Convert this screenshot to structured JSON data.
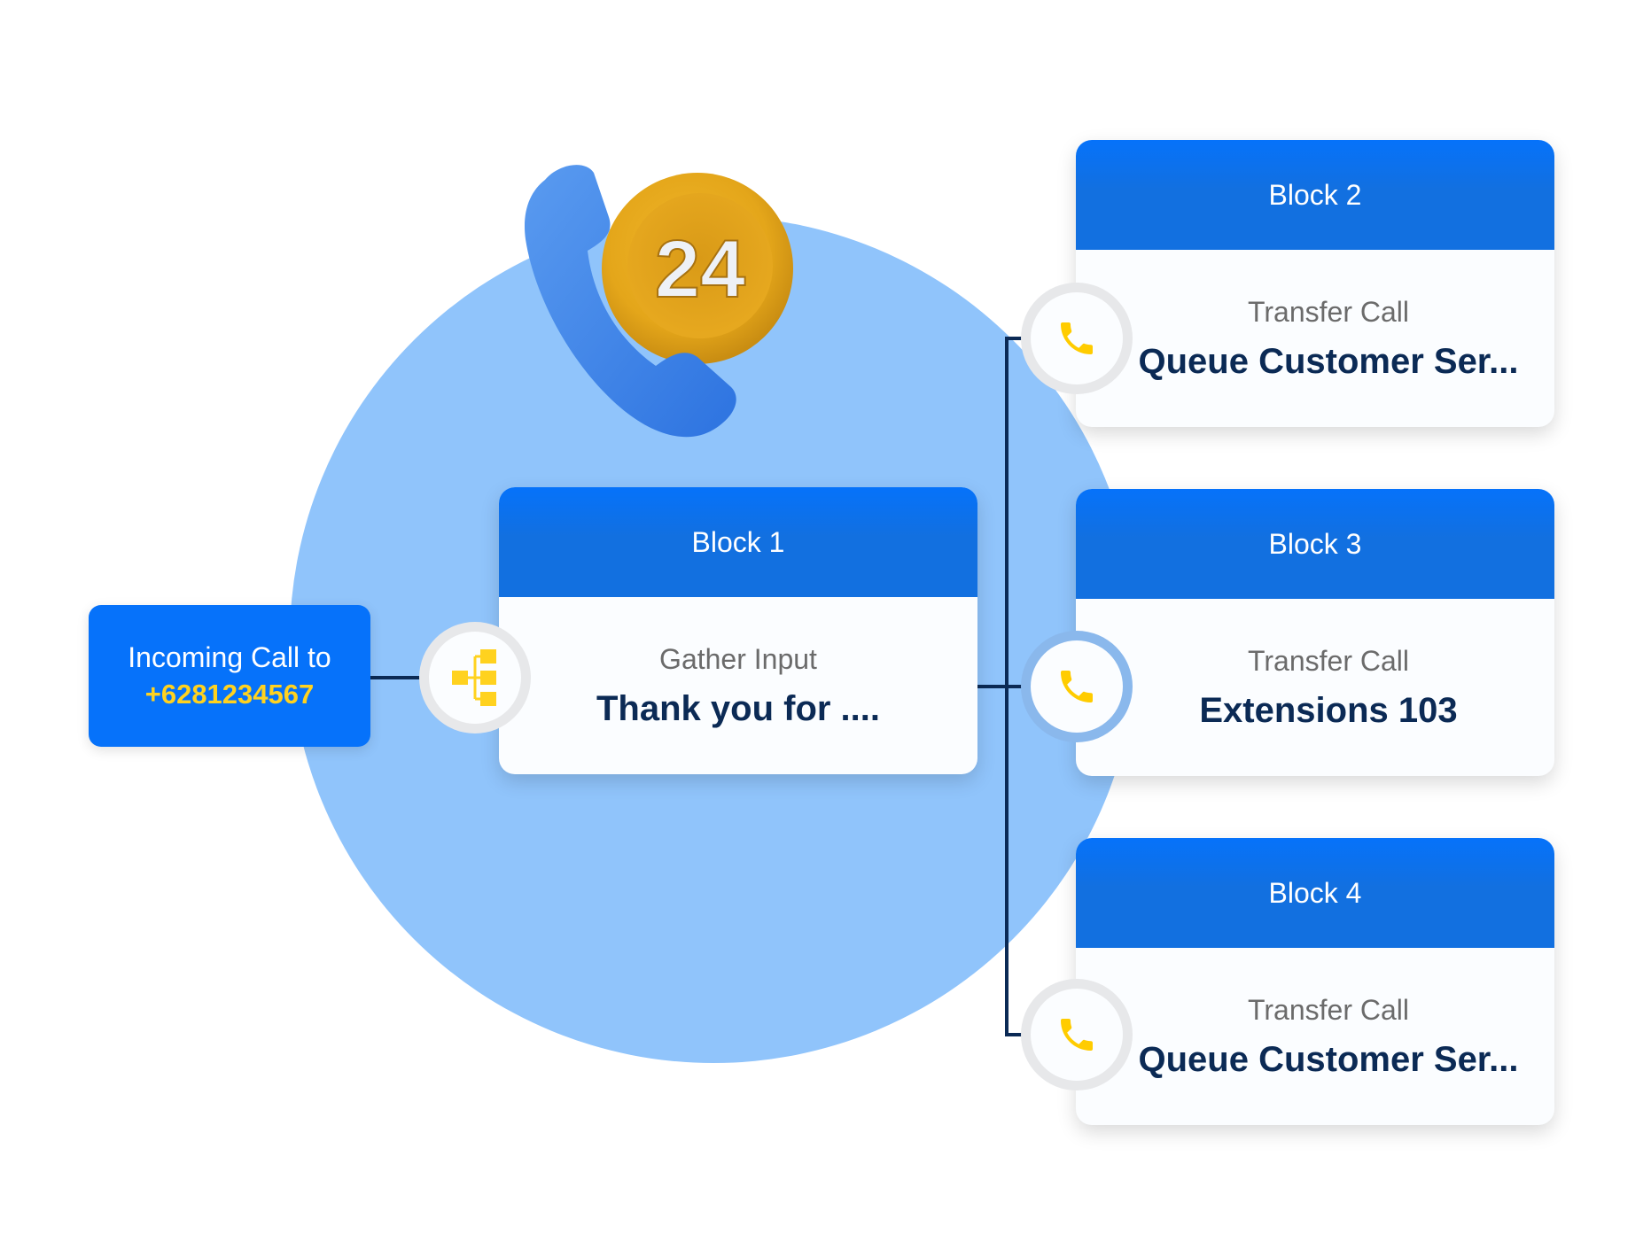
{
  "colors": {
    "primary_blue": "#0672fa",
    "header_blue": "#1270e0",
    "circle_blue": "#90c4fb",
    "accent_yellow": "#ffd21f",
    "connector": "#0b2a55"
  },
  "hero": {
    "icon": "24-hour-phone-icon",
    "badge_text": "24"
  },
  "incoming": {
    "label": "Incoming Call to",
    "number": "+6281234567"
  },
  "blocks": [
    {
      "title": "Block 1",
      "type": "Gather Input",
      "value": "Thank you for ....",
      "icon": "flow-hierarchy-icon"
    },
    {
      "title": "Block 2",
      "type": "Transfer Call",
      "value": "Queue Customer Ser...",
      "icon": "phone-icon"
    },
    {
      "title": "Block 3",
      "type": "Transfer Call",
      "value": "Extensions 103",
      "icon": "phone-icon"
    },
    {
      "title": "Block 4",
      "type": "Transfer Call",
      "value": "Queue Customer Ser...",
      "icon": "phone-icon"
    }
  ]
}
